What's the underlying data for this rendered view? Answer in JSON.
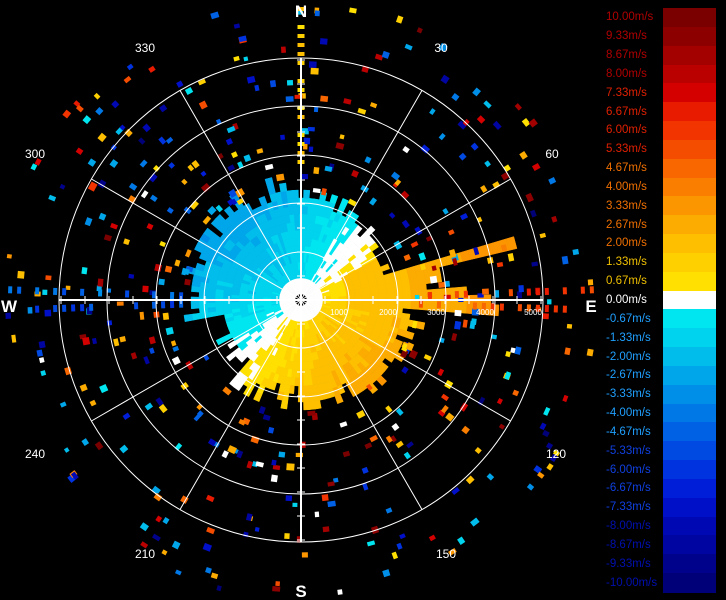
{
  "chart_data": {
    "type": "polar-radar",
    "title": "",
    "compass": {
      "north": "N",
      "east": "E",
      "south": "S",
      "west": "W"
    },
    "azimuth_labels": [
      "30",
      "60",
      "120",
      "150",
      "210",
      "240",
      "300",
      "330"
    ],
    "range_labels": [
      "1000",
      "2000",
      "3000",
      "4000",
      "5000"
    ],
    "range_max": 5000,
    "grid": true,
    "legend": {
      "placement": "right",
      "unit": "m/s",
      "entries": [
        {
          "label": "10.00m/s",
          "value": 10.0,
          "color": "#7a0000"
        },
        {
          "label": "9.33m/s",
          "value": 9.33,
          "color": "#8c0000"
        },
        {
          "label": "8.67m/s",
          "value": 8.67,
          "color": "#a30000"
        },
        {
          "label": "8.00m/s",
          "value": 8.0,
          "color": "#bb0000"
        },
        {
          "label": "7.33m/s",
          "value": 7.33,
          "color": "#d40000"
        },
        {
          "label": "6.67m/s",
          "value": 6.67,
          "color": "#e81a00"
        },
        {
          "label": "6.00m/s",
          "value": 6.0,
          "color": "#f23400"
        },
        {
          "label": "5.33m/s",
          "value": 5.33,
          "color": "#f54d00"
        },
        {
          "label": "4.67m/s",
          "value": 4.67,
          "color": "#f86700"
        },
        {
          "label": "4.00m/s",
          "value": 4.0,
          "color": "#fa7f00"
        },
        {
          "label": "3.33m/s",
          "value": 3.33,
          "color": "#fb9500"
        },
        {
          "label": "2.67m/s",
          "value": 2.67,
          "color": "#fcab00"
        },
        {
          "label": "2.00m/s",
          "value": 2.0,
          "color": "#fdbf00"
        },
        {
          "label": "1.33m/s",
          "value": 1.33,
          "color": "#fed000"
        },
        {
          "label": "0.67m/s",
          "value": 0.67,
          "color": "#ffe000"
        },
        {
          "label": "0.00m/s",
          "value": 0.0,
          "color": "#ffffff"
        },
        {
          "label": "-0.67m/s",
          "value": -0.67,
          "color": "#00e6f0"
        },
        {
          "label": "-1.33m/s",
          "value": -1.33,
          "color": "#00d3ee"
        },
        {
          "label": "-2.00m/s",
          "value": -2.0,
          "color": "#00bdec"
        },
        {
          "label": "-2.67m/s",
          "value": -2.67,
          "color": "#00a6ea"
        },
        {
          "label": "-3.33m/s",
          "value": -3.33,
          "color": "#008fe8"
        },
        {
          "label": "-4.00m/s",
          "value": -4.0,
          "color": "#0078e6"
        },
        {
          "label": "-4.67m/s",
          "value": -4.67,
          "color": "#0061e4"
        },
        {
          "label": "-5.33m/s",
          "value": -5.33,
          "color": "#004ae2"
        },
        {
          "label": "-6.00m/s",
          "value": -6.0,
          "color": "#0033e0"
        },
        {
          "label": "-6.67m/s",
          "value": -6.67,
          "color": "#001ed8"
        },
        {
          "label": "-7.33m/s",
          "value": -7.33,
          "color": "#000fc8"
        },
        {
          "label": "-8.00m/s",
          "value": -8.0,
          "color": "#0008b4"
        },
        {
          "label": "-8.67m/s",
          "value": -8.67,
          "color": "#0004a0"
        },
        {
          "label": "-9.33m/s",
          "value": -9.33,
          "color": "#00028c"
        },
        {
          "label": "-10.00m/s",
          "value": -10.0,
          "color": "#000078"
        }
      ]
    }
  }
}
